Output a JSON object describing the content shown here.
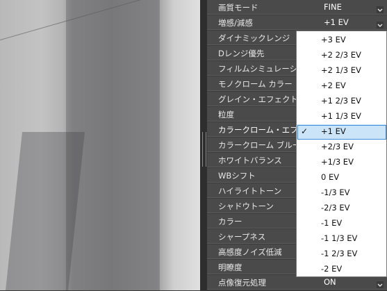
{
  "settings": [
    {
      "label": "画質モード",
      "value": "FINE",
      "name": "setting-image-quality"
    },
    {
      "label": "増感/減感",
      "value": "+1 EV",
      "name": "setting-push-pull"
    },
    {
      "label": "ダイナミックレンジ",
      "name": "setting-dynamic-range"
    },
    {
      "label": "Dレンジ優先",
      "name": "setting-d-range-priority"
    },
    {
      "label": "フィルムシミュレーション",
      "name": "setting-film-simulation"
    },
    {
      "label": "モノクローム カラー",
      "name": "setting-monochrome-color"
    },
    {
      "label": "グレイン・エフェクト",
      "name": "setting-grain-effect"
    },
    {
      "label": "粒度",
      "name": "setting-grain-size"
    },
    {
      "label": "カラークローム・エフェクト",
      "name": "setting-color-chrome-effect"
    },
    {
      "label": "カラークローム ブルー",
      "name": "setting-color-chrome-blue"
    },
    {
      "label": "ホワイトバランス",
      "name": "setting-white-balance"
    },
    {
      "label": "WBシフト",
      "name": "setting-wb-shift"
    },
    {
      "label": "ハイライトトーン",
      "name": "setting-highlight-tone"
    },
    {
      "label": "シャドウトーン",
      "name": "setting-shadow-tone"
    },
    {
      "label": "カラー",
      "name": "setting-color"
    },
    {
      "label": "シャープネス",
      "name": "setting-sharpness"
    },
    {
      "label": "高感度ノイズ低減",
      "name": "setting-high-iso-nr"
    },
    {
      "label": "明瞭度",
      "name": "setting-clarity"
    },
    {
      "label": "点像復元処理",
      "value": "ON",
      "name": "setting-lens-modulation-optimizer"
    }
  ],
  "dropdown": {
    "options": [
      "+3 EV",
      "+2 2/3 EV",
      "+2 1/3 EV",
      "+2 EV",
      "+1 2/3 EV",
      "+1 1/3 EV",
      "+1 EV",
      "+2/3 EV",
      "+1/3 EV",
      "0 EV",
      "-1/3 EV",
      "-2/3 EV",
      "-1 EV",
      "-1 1/3 EV",
      "-1 2/3 EV",
      "-2 EV"
    ],
    "selected_index": 6,
    "check_glyph": "✓"
  },
  "icons": {
    "chevron": "chevron-down-icon",
    "check": "check-icon",
    "grip": "splitter-grip"
  }
}
